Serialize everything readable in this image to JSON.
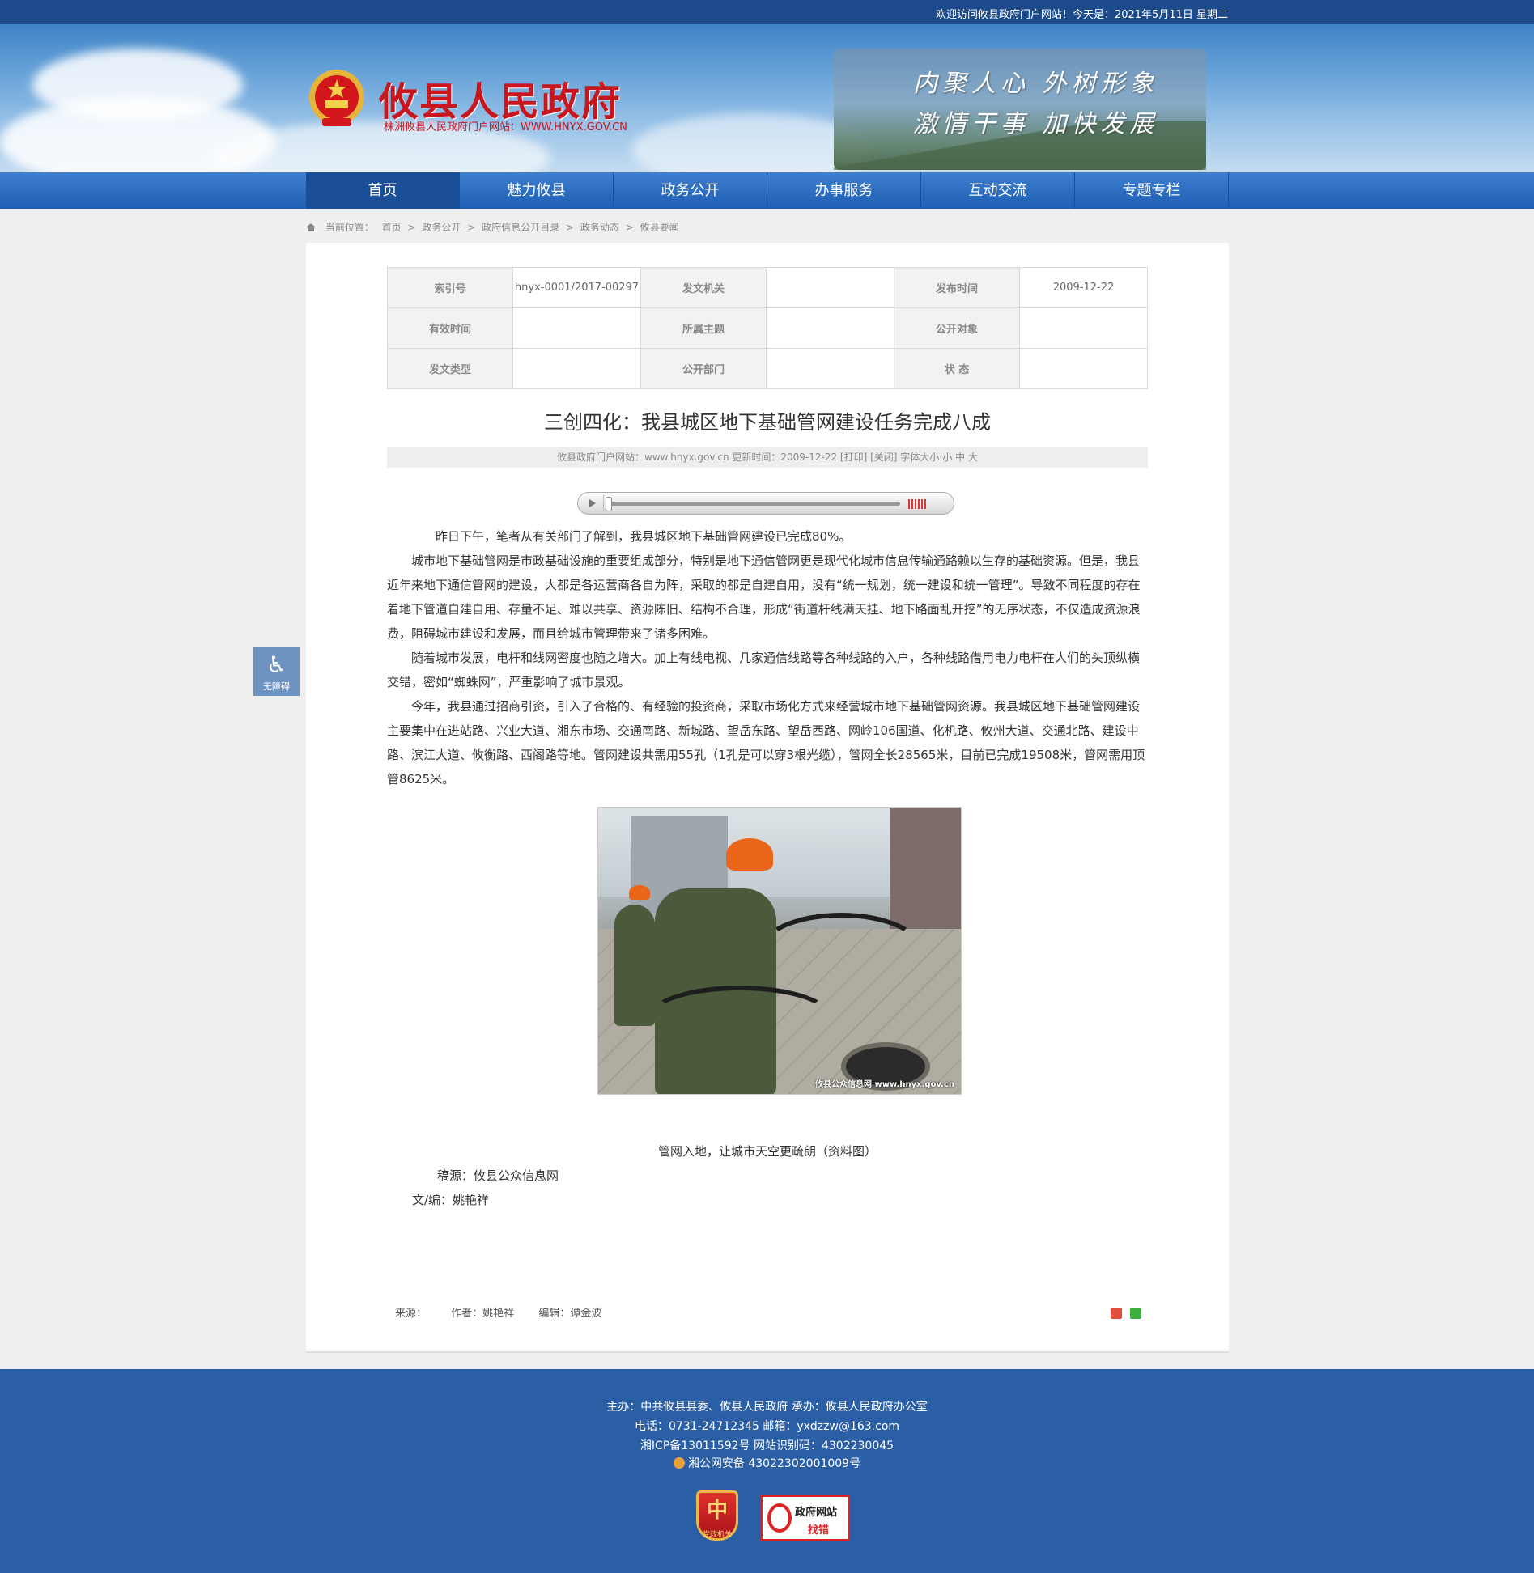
{
  "topbar": {
    "welcome": "欢迎访问攸县政府门户网站！今天是：2021年5月11日 星期二"
  },
  "header": {
    "site_name": "攸县人民政府",
    "site_sub": "株洲攸县人民政府门户网站：WWW.HNYX.GOV.CN",
    "slogan1": "内聚人心  外树形象",
    "slogan2": "激情干事  加快发展"
  },
  "nav": {
    "items": [
      {
        "label": "首页"
      },
      {
        "label": "魅力攸县"
      },
      {
        "label": "政务公开"
      },
      {
        "label": "办事服务"
      },
      {
        "label": "互动交流"
      },
      {
        "label": "专题专栏"
      }
    ]
  },
  "breadcrumb": {
    "prefix": "当前位置：",
    "items": [
      "首页",
      "政务公开",
      "政府信息公开目录",
      "政务动态",
      "攸县要闻"
    ],
    "sep": ">"
  },
  "meta": {
    "index_label": "索引号",
    "index_value": "hnyx-0001/2017-00297",
    "issuer_label": "发文机关",
    "issuer_value": "",
    "date_label": "发布时间",
    "date_value": "2009-12-22",
    "valid_label": "有效时间",
    "valid_value": "",
    "topic_label": "所属主题",
    "topic_value": "",
    "target_label": "公开对象",
    "target_value": "",
    "type_label": "发文类型",
    "type_value": "",
    "dept_label": "公开部门",
    "dept_value": "",
    "status_label": "状 态",
    "status_value": ""
  },
  "article": {
    "title": "三创四化：我县城区地下基础管网建设任务完成八成",
    "info": "攸县政府门户网站：www.hnyx.gov.cn   更新时间：2009-12-22  [打印] [关闭]  字体大小:小 中 大",
    "p1": "昨日下午，笔者从有关部门了解到，我县城区地下基础管网建设已完成80%。",
    "p2": "城市地下基础管网是市政基础设施的重要组成部分，特别是地下通信管网更是现代化城市信息传输通路赖以生存的基础资源。但是，我县近年来地下通信管网的建设，大都是各运营商各自为阵，采取的都是自建自用，没有“统一规划，统一建设和统一管理”。导致不同程度的存在着地下管道自建自用、存量不足、难以共享、资源陈旧、结构不合理，形成“街道杆线满天挂、地下路面乱开挖”的无序状态，不仅造成资源浪费，阻碍城市建设和发展，而且给城市管理带来了诸多困难。",
    "p3": "随着城市发展，电杆和线网密度也随之增大。加上有线电视、几家通信线路等各种线路的入户，各种线路借用电力电杆在人们的头顶纵横交错，密如“蜘蛛网”，严重影响了城市景观。",
    "p4": "今年，我县通过招商引资，引入了合格的、有经验的投资商，采取市场化方式来经营城市地下基础管网资源。我县城区地下基础管网建设主要集中在进站路、兴业大道、湘东市场、交通南路、新城路、望岳东路、望岳西路、网岭106国道、化机路、攸州大道、交通北路、建设中路、滨江大道、攸衡路、西阁路等地。管网建设共需用55孔（1孔是可以穿3根光缆），管网全长28565米，目前已完成19508米，管网需用顶管8625米。",
    "photo_watermark": "攸县公众信息网 www.hnyx.gov.cn",
    "caption": "管网入地，让城市天空更疏朗（资料图）",
    "source": "稿源：攸县公众信息网",
    "editor": "文/编：姚艳祥"
  },
  "footer_meta": {
    "source": "来源：",
    "author": "作者：姚艳祥",
    "editor": "编辑：谭金波"
  },
  "a11y": {
    "label": "无障碍"
  },
  "footer": {
    "line1": "主办：中共攸县县委、攸县人民政府 承办：攸县人民政府办公室",
    "line2": "电话：0731-24712345 邮箱：yxdzzw@163.com",
    "line3": "湘ICP备13011592号    网站识别码：4302230045",
    "line4": "湘公网安备 43022302001009号",
    "badge1_glyph": "中",
    "badge1_text": "党政机关",
    "badge2_line1": "政府网站",
    "badge2_line2": "找错"
  },
  "colors": {
    "nav": "#1f5fb4",
    "topbar": "#1c4a8a",
    "footer": "#2a5ea5",
    "brand_red": "#c7161d"
  }
}
